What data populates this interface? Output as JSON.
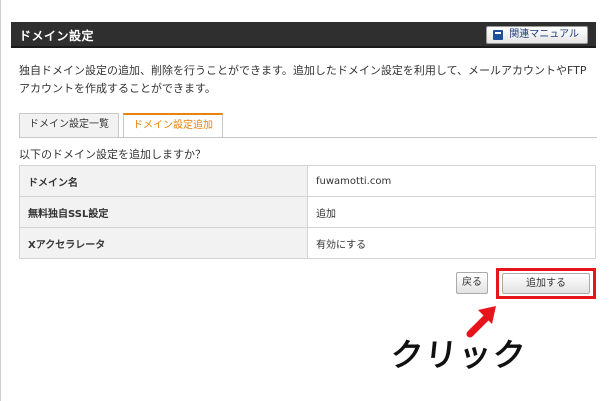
{
  "header": {
    "title": "ドメイン設定",
    "manual_label": "関連マニュアル"
  },
  "description": "独自ドメイン設定の追加、削除を行うことができます。追加したドメイン設定を利用して、メールアカウントやFTPアカウントを作成することができます。",
  "tabs": [
    {
      "label": "ドメイン設定一覧",
      "active": false
    },
    {
      "label": "ドメイン設定追加",
      "active": true
    }
  ],
  "question": "以下のドメイン設定を追加しますか？",
  "rows": [
    {
      "label": "ドメイン名",
      "value": "fuwamotti.com"
    },
    {
      "label": "無料独自SSL設定",
      "value": "追加"
    },
    {
      "label": "Xアクセラレータ",
      "value": "有効にする"
    }
  ],
  "buttons": {
    "back_label": "戻る",
    "add_label": "追加する"
  },
  "annotation": {
    "click_text": "クリック",
    "highlight_color": "#e8141c"
  },
  "colors": {
    "header_bg": "#2f2f2f",
    "active_tab": "#e8830c"
  }
}
